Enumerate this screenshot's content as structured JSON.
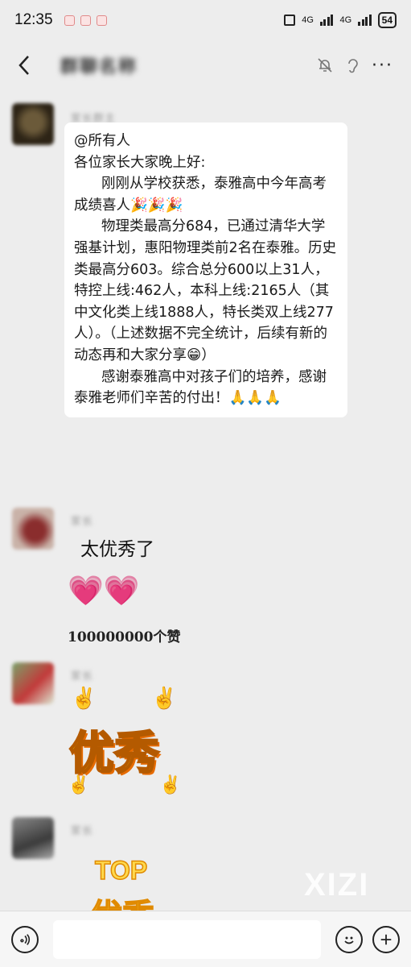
{
  "status_bar": {
    "time": "12:35",
    "network_1": "4G",
    "network_2": "4G",
    "battery": "54"
  },
  "nav": {
    "title": "群聊名称",
    "more_label": "···"
  },
  "messages": [
    {
      "sender": "家长群主",
      "lines": [
        "@所有人",
        "各位家长大家晚上好:",
        "刚刚从学校获悉，泰雅高中今年高考成绩喜人🎉🎉🎉",
        "物理类最高分684，已通过清华大学强基计划，惠阳物理类前2名在泰雅。历史类最高分603。综合总分600以上31人，特控上线:462人，本科上线:2165人（其中文化类上线1888人，特长类双上线277人）。（上述数据不完全统计，后续有新的动态再和大家分享😁）",
        "感谢泰雅高中对孩子们的培养，感谢泰雅老师们辛苦的付出！🙏🙏🙏"
      ]
    },
    {
      "sender": "家长",
      "text": "太优秀了",
      "hearts": "💗💗",
      "likes": "100000000个赞"
    },
    {
      "sender": "家长",
      "sticker_text": "优秀",
      "sticker_icon": "✌️"
    },
    {
      "sender": "家长",
      "sticker_text": "TOP",
      "sticker_sub": "优秀"
    }
  ],
  "watermark": "XIZI",
  "colors": {
    "background": "#ededed",
    "bubble": "#ffffff",
    "sticker_yellow": "#ffd400",
    "sticker_orange": "#ff9500"
  },
  "icons": [
    "back-icon",
    "mute-icon",
    "ear-icon",
    "more-icon",
    "voice-icon",
    "emoji-icon",
    "plus-icon"
  ]
}
